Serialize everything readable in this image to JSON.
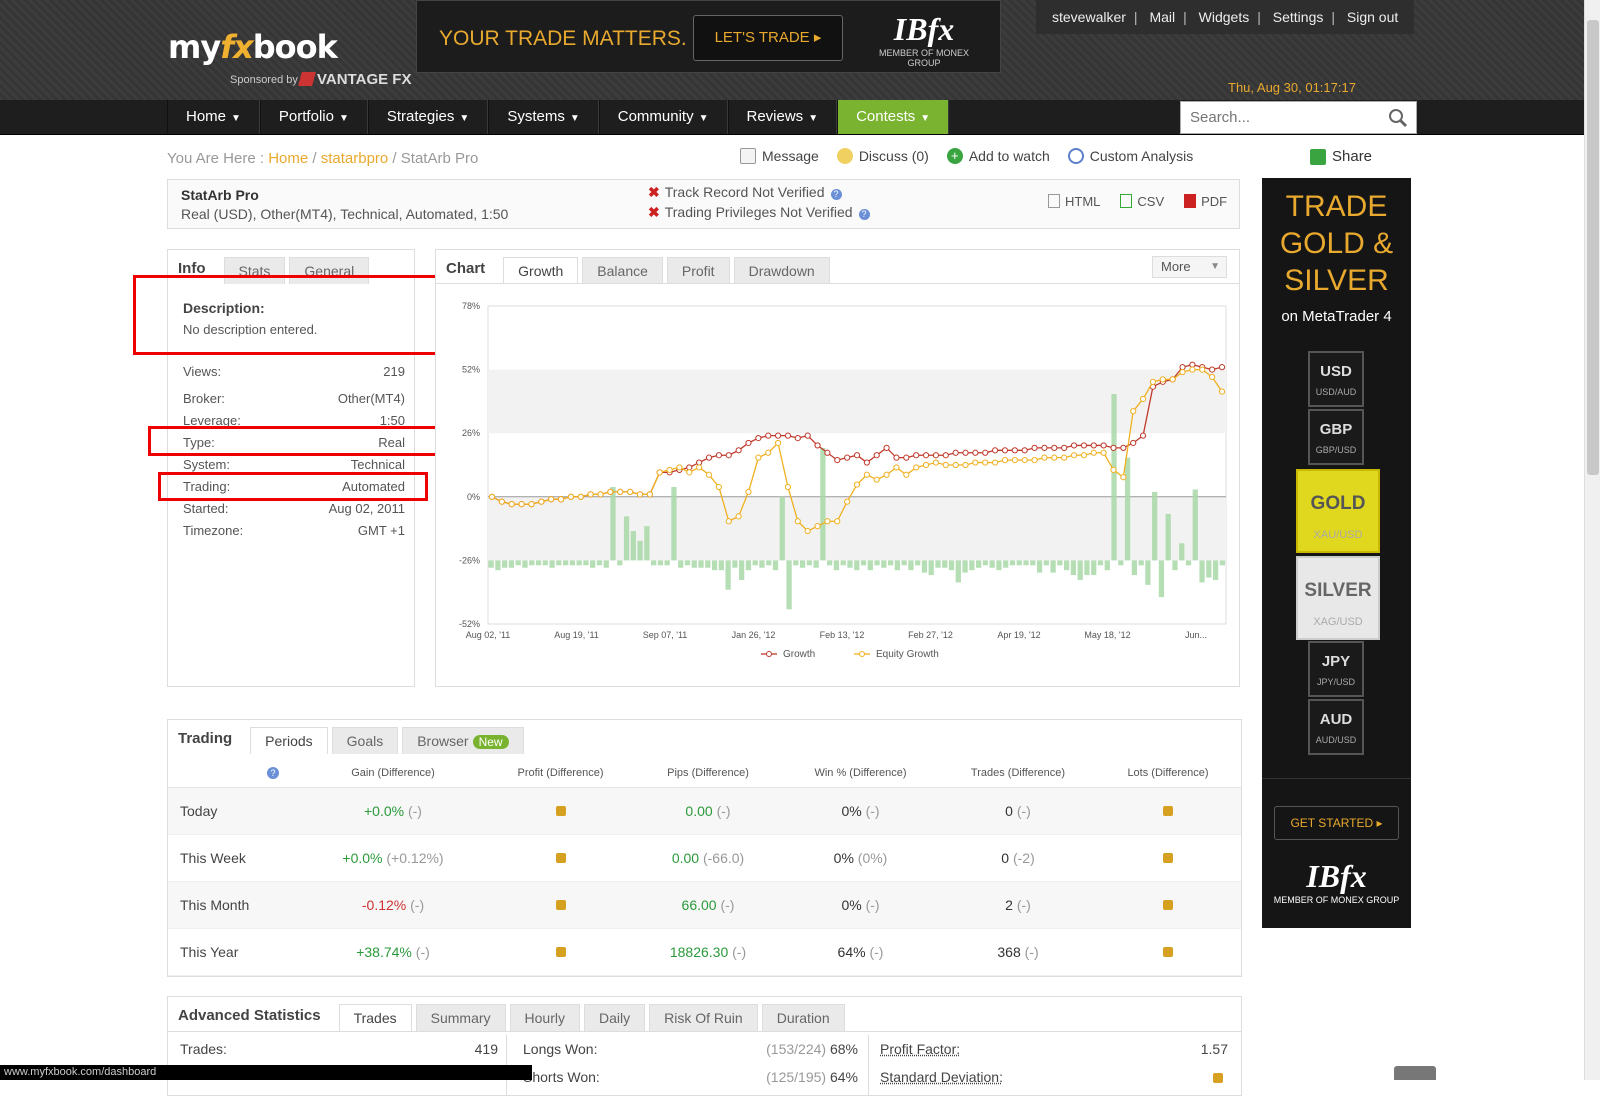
{
  "brand": {
    "logo_my": "my",
    "logo_fx": "fx",
    "logo_book": "book",
    "sponsored": "Sponsored by",
    "sponsor_name": "VANTAGE FX"
  },
  "banner": {
    "message": "YOUR TRADE MATTERS.",
    "button": "LET'S TRADE",
    "brand": "IBfx",
    "tagline": "MEMBER OF MONEX GROUP"
  },
  "usernav": [
    "stevewalker",
    "Mail",
    "Widgets",
    "Settings",
    "Sign out"
  ],
  "datetime": "Thu, Aug 30, 01:17:17",
  "mainnav": [
    {
      "label": "Home"
    },
    {
      "label": "Portfolio"
    },
    {
      "label": "Strategies"
    },
    {
      "label": "Systems"
    },
    {
      "label": "Community"
    },
    {
      "label": "Reviews"
    },
    {
      "label": "Contests",
      "active": true
    }
  ],
  "search": {
    "placeholder": "Search..."
  },
  "breadcrumb": {
    "prefix": "You Are Here :",
    "home": "Home",
    "user": "statarbpro",
    "current": "StatArb Pro"
  },
  "actions": {
    "message": "Message",
    "discuss": "Discuss (0)",
    "watch": "Add to watch",
    "custom": "Custom Analysis",
    "share": "Share"
  },
  "account": {
    "name": "StatArb Pro",
    "details": "Real (USD), Other(MT4), Technical, Automated, 1:50",
    "track": "Track Record Not Verified",
    "privileges": "Trading Privileges Not Verified",
    "exports": [
      "HTML",
      "CSV",
      "PDF"
    ]
  },
  "info": {
    "tabs": [
      "Info",
      "Stats",
      "General"
    ],
    "desc_label": "Description:",
    "desc_text": "No description entered.",
    "rows": [
      {
        "k": "Views:",
        "v": "219"
      },
      {
        "k": "Broker:",
        "v": "Other(MT4)"
      },
      {
        "k": "Leverage:",
        "v": "1:50"
      },
      {
        "k": "Type:",
        "v": "Real"
      },
      {
        "k": "System:",
        "v": "Technical"
      },
      {
        "k": "Trading:",
        "v": "Automated"
      },
      {
        "k": "Started:",
        "v": "Aug 02, 2011"
      },
      {
        "k": "Timezone:",
        "v": "GMT +1"
      }
    ]
  },
  "chart_panel": {
    "title": "Chart",
    "tabs": [
      "Growth",
      "Balance",
      "Profit",
      "Drawdown"
    ],
    "more": "More"
  },
  "chart_data": {
    "type": "line",
    "y_ticks": [
      "78%",
      "52%",
      "26%",
      "0%",
      "-26%",
      "-52%"
    ],
    "ylim": [
      -52,
      78
    ],
    "x_ticks": [
      "Aug 02, '11",
      "Aug 19, '11",
      "Sep 07, '11",
      "Jan 26, '12",
      "Feb 13, '12",
      "Feb 27, '12",
      "Apr 19, '12",
      "May 18, '12",
      "Jun..."
    ],
    "series": [
      {
        "name": "Growth",
        "color": "#c0392b",
        "values": [
          0,
          -2,
          -3,
          -3,
          -3,
          -2,
          -1,
          -1,
          0,
          0,
          1,
          1,
          2,
          2,
          2,
          1,
          1,
          10,
          10,
          11,
          12,
          14,
          16,
          17,
          17,
          19,
          22,
          24,
          25,
          25,
          25,
          24,
          25,
          21,
          18,
          15,
          16,
          17,
          14,
          17,
          20,
          16,
          16,
          17,
          17,
          17,
          17,
          18,
          18,
          18,
          18,
          19,
          19,
          19,
          19,
          20,
          20,
          20,
          20,
          21,
          21,
          21,
          21,
          20,
          20,
          22,
          25,
          45,
          47,
          48,
          53,
          54,
          53,
          52,
          53
        ]
      },
      {
        "name": "Equity Growth",
        "color": "#f0b020",
        "values": [
          0,
          -2,
          -3,
          -3,
          -3,
          -2,
          -1,
          -1,
          0,
          0,
          1,
          1,
          2,
          2,
          2,
          1,
          1,
          10,
          11,
          12,
          10,
          12,
          9,
          4,
          -10,
          -8,
          2,
          16,
          18,
          22,
          4,
          -10,
          -14,
          -12,
          -10,
          -10,
          -2,
          5,
          9,
          7,
          9,
          12,
          9,
          12,
          13,
          14,
          13,
          13,
          13,
          14,
          14,
          14,
          15,
          15,
          15,
          15,
          16,
          16,
          16,
          17,
          17,
          18,
          18,
          11,
          8,
          35,
          40,
          47,
          48,
          48,
          51,
          52,
          52,
          49,
          43
        ]
      }
    ],
    "bars": [
      -3,
      -4,
      -3,
      -3,
      -2,
      -3,
      -2,
      -2,
      -2,
      -3,
      -2,
      -2,
      -2,
      -2,
      -2,
      -3,
      -2,
      -3,
      30,
      -2,
      18,
      12,
      8,
      14,
      -2,
      -2,
      -2,
      30,
      -3,
      -2,
      -3,
      -3,
      -3,
      -4,
      -4,
      -12,
      -3,
      -8,
      -4,
      -2,
      -3,
      -2,
      -4,
      26,
      -20,
      -2,
      -3,
      -2,
      -3,
      46,
      -2,
      -4,
      -2,
      -3,
      -4,
      -2,
      -4,
      -2,
      -3,
      -2,
      -4,
      -2,
      -4,
      -2,
      -5,
      -6,
      -3,
      -3,
      -4,
      -9,
      -5,
      -4,
      -3,
      -2,
      -3,
      -4,
      -3,
      -2,
      -2,
      -2,
      -2,
      -5,
      -2,
      -5,
      -2,
      -4,
      -6,
      -8,
      -6,
      -6,
      -2,
      -4,
      68,
      -2,
      42,
      -6,
      -2,
      -10,
      28,
      -15,
      19,
      -4,
      7,
      -2,
      29,
      -9,
      -7,
      -8,
      -2
    ]
  },
  "trading": {
    "title": "Trading",
    "tabs": [
      "Periods",
      "Goals",
      "Browser"
    ],
    "new_badge": "New",
    "headers": [
      "Gain (Difference)",
      "Profit (Difference)",
      "Pips (Difference)",
      "Win % (Difference)",
      "Trades (Difference)",
      "Lots (Difference)"
    ],
    "rows": [
      {
        "period": "Today",
        "gain": "+0.0%",
        "gain_diff": "(-)",
        "gain_color": "g",
        "pips": "0.00",
        "pips_diff": "(-)",
        "win": "0%",
        "win_diff": "(-)",
        "trades": "0",
        "trades_diff": "(-)"
      },
      {
        "period": "This Week",
        "gain": "+0.0%",
        "gain_diff": "(+0.12%)",
        "gain_color": "g",
        "pips": "0.00",
        "pips_diff": "(-66.0)",
        "win": "0%",
        "win_diff": "(0%)",
        "trades": "0",
        "trades_diff": "(-2)"
      },
      {
        "period": "This Month",
        "gain": "-0.12%",
        "gain_diff": "(-)",
        "gain_color": "r",
        "pips": "66.00",
        "pips_diff": "(-)",
        "win": "0%",
        "win_diff": "(-)",
        "trades": "2",
        "trades_diff": "(-)"
      },
      {
        "period": "This Year",
        "gain": "+38.74%",
        "gain_diff": "(-)",
        "gain_color": "g",
        "pips": "18826.30",
        "pips_diff": "(-)",
        "win": "64%",
        "win_diff": "(-)",
        "trades": "368",
        "trades_diff": "(-)"
      }
    ]
  },
  "advanced": {
    "title": "Advanced Statistics",
    "tabs": [
      "Trades",
      "Summary",
      "Hourly",
      "Daily",
      "Risk Of Ruin",
      "Duration"
    ],
    "trades_label": "Trades:",
    "trades_value": "419",
    "longs_label": "Longs Won:",
    "longs_detail": "(153/224)",
    "longs_pct": "68%",
    "shorts_label": "Shorts Won:",
    "shorts_detail": "(125/195)",
    "shorts_pct": "64%",
    "pf_label": "Profit Factor:",
    "pf_value": "1.57",
    "sd_label": "Standard Deviation:"
  },
  "ad": {
    "h1": "TRADE",
    "h2": "GOLD &",
    "h3": "SILVER",
    "sub": "on MetaTrader 4",
    "pairs": [
      {
        "c": "USD",
        "p": "USD/AUD"
      },
      {
        "c": "GBP",
        "p": "GBP/USD"
      },
      {
        "c": "GOLD",
        "p": "XAU/USD"
      },
      {
        "c": "SILVER",
        "p": "XAG/USD"
      },
      {
        "c": "JPY",
        "p": "JPY/USD"
      },
      {
        "c": "AUD",
        "p": "AUD/USD"
      }
    ],
    "cta": "GET STARTED",
    "brand": "IBfx",
    "tagline": "MEMBER OF MONEX GROUP"
  },
  "status_url": "www.myfxbook.com/dashboard"
}
